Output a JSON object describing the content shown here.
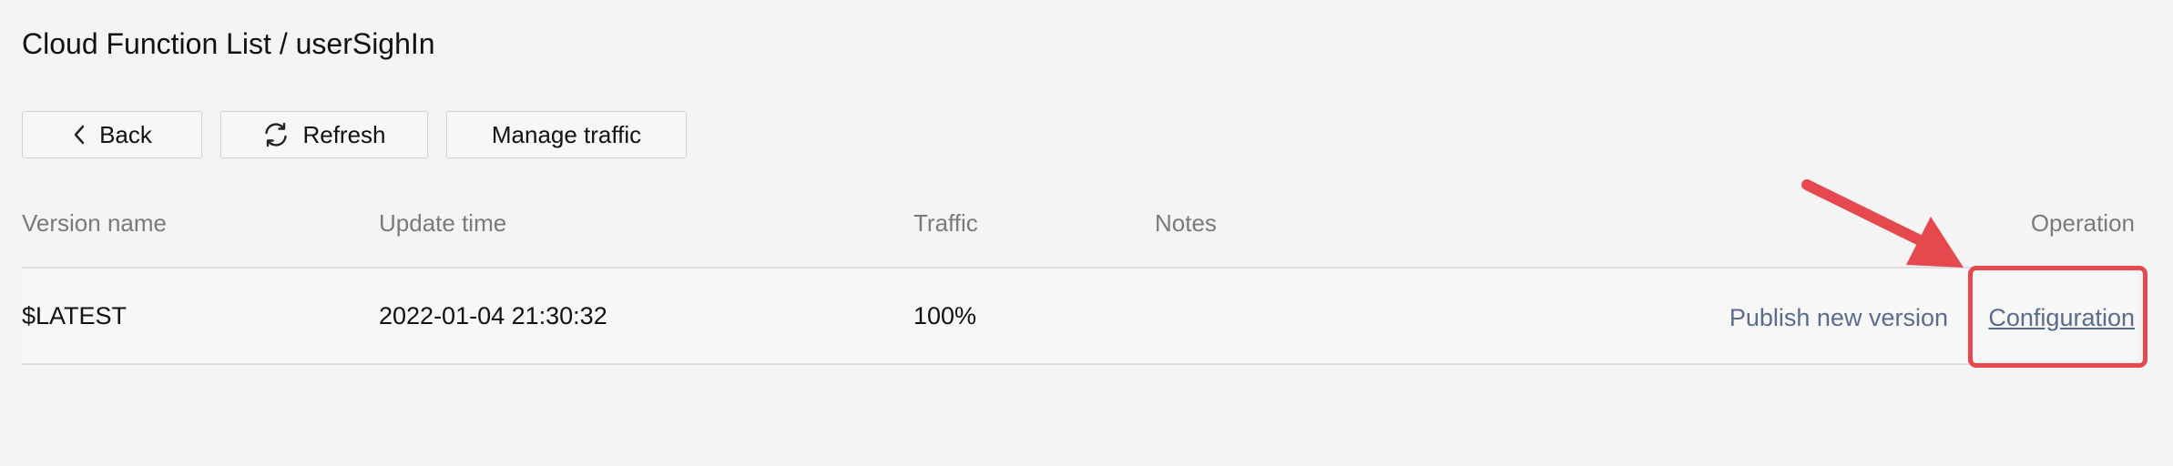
{
  "page": {
    "title": "Cloud Function List / userSighIn"
  },
  "toolbar": {
    "back_label": "Back",
    "refresh_label": "Refresh",
    "manage_traffic_label": "Manage traffic"
  },
  "table": {
    "columns": [
      "Version name",
      "Update time",
      "Traffic",
      "Notes",
      "Operation"
    ],
    "rows": [
      {
        "version_name": "$LATEST",
        "update_time": "2022-01-04 21:30:32",
        "traffic": "100%",
        "notes": "",
        "actions": {
          "publish": "Publish new version",
          "configuration": "Configuration"
        }
      }
    ]
  },
  "annotation": {
    "color": "#e5484d",
    "target": "configuration-link"
  },
  "icons": {
    "back": "chevron-left-icon",
    "refresh": "refresh-icon",
    "annotation": "arrow-icon"
  },
  "colors": {
    "background": "#f4f4f4",
    "link": "#5b6b8e",
    "header_text": "#7a7a7a"
  }
}
